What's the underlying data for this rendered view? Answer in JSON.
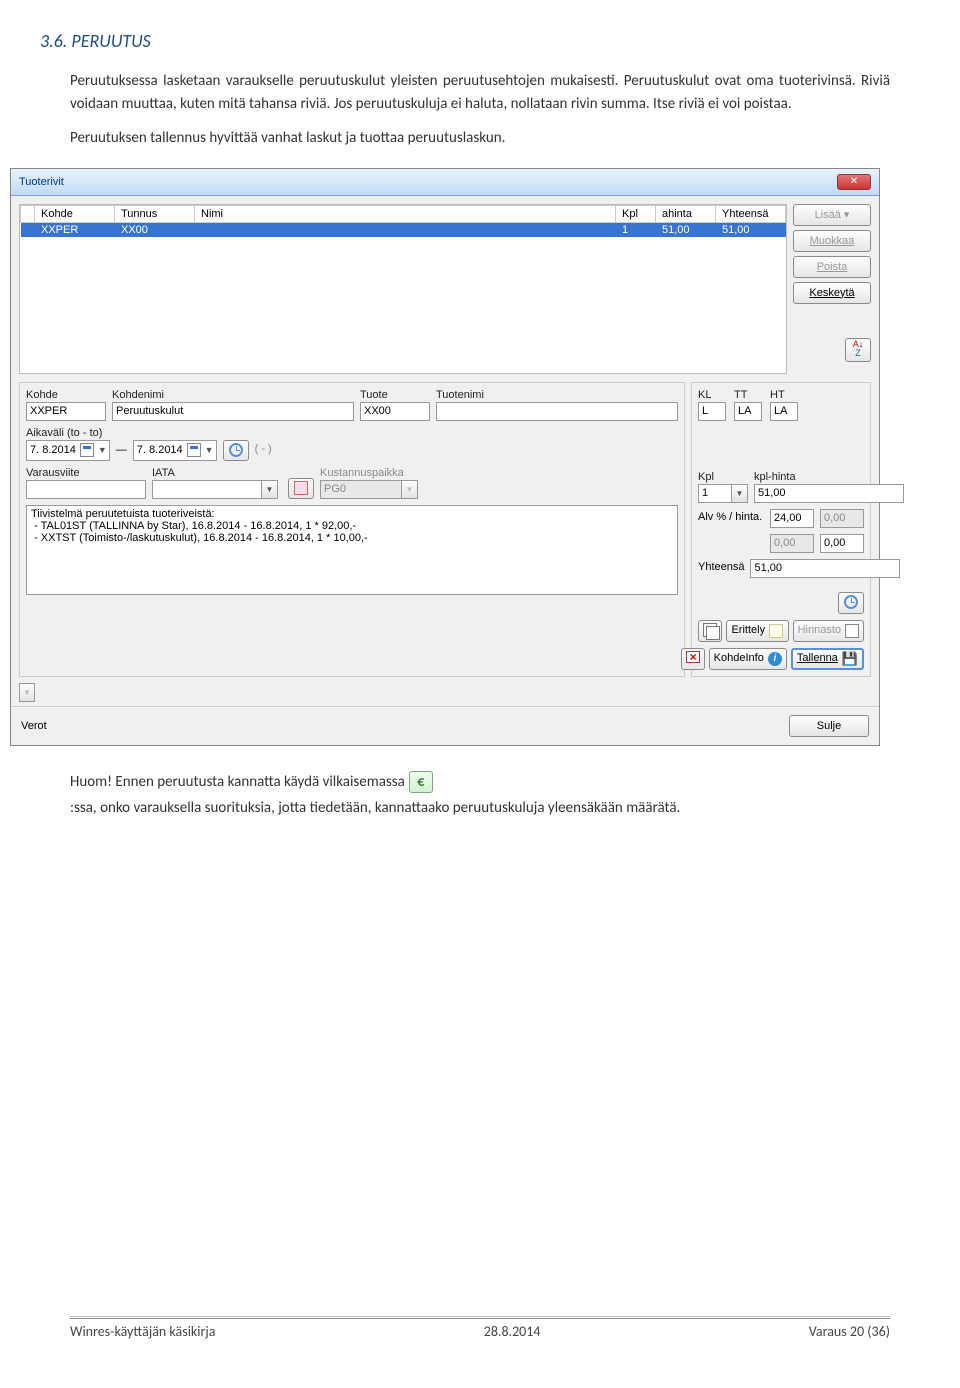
{
  "doc": {
    "heading": "3.6. PERUUTUS",
    "para1": "Peruutuksessa lasketaan varaukselle peruutuskulut yleisten peruutusehtojen mukaisesti. Peruutuskulut ovat oma tuoterivinsä. Riviä voidaan muuttaa, kuten mitä tahansa riviä. Jos peruutuskuluja ei haluta, nollataan rivin summa. Itse riviä ei voi poistaa.",
    "para2": "Peruutuksen tallennus hyvittää vanhat laskut ja tuottaa peruutuslaskun.",
    "note_before": " Huom! Ennen peruutusta kannatta käydä vilkaisemassa ",
    "note_after": ":ssa, onko varauksella suorituksia, jotta tiedetään, kannattaako peruutuskuluja yleensäkään määrätä.",
    "euro": "€"
  },
  "window": {
    "title": "Tuoterivit",
    "grid": {
      "cols": [
        "Kohde",
        "Tunnus",
        "Nimi",
        "Kpl",
        "ahinta",
        "Yhteensä"
      ],
      "row": {
        "kohde": "XXPER",
        "tunnus": "XX00",
        "nimi": "",
        "kpl": "1",
        "ahinta": "51,00",
        "yht": "51,00"
      }
    },
    "buttons": {
      "add": "Lisää ▾",
      "edit": "Muokkaa",
      "delete": "Poista",
      "cancel": "Keskeytä",
      "sort_a": "A",
      "sort_z": "Z"
    },
    "form": {
      "labels": {
        "kohde": "Kohde",
        "kohdenimi": "Kohdenimi",
        "tuote": "Tuote",
        "tuotenimi": "Tuotenimi",
        "kl": "KL",
        "tt": "TT",
        "ht": "HT",
        "aikavali": "Aikaväli (to - to)",
        "varausviite": "Varausviite",
        "iata": "IATA",
        "kustannus": "Kustannuspaikka",
        "kpl": "Kpl",
        "kplhinta": "kpl-hinta",
        "alv": "Alv % / hinta.",
        "yhteensa": "Yhteensä"
      },
      "values": {
        "kohde": "XXPER",
        "kohdenimi": "Peruutuskulut",
        "tuote": "XX00",
        "tuotenimi": "",
        "kl": "L",
        "tt": "LA",
        "ht": "LA",
        "date1": "7. 8.2014",
        "date2": "7. 8.2014",
        "timerange": "( - )",
        "varausviite": "",
        "iata": "",
        "kustannus": "PG0",
        "kpl": "1",
        "kplhinta": "51,00",
        "alvpct": "24,00",
        "alvval": "0,00",
        "z1": "0,00",
        "z2": "0,00",
        "yhteensa": "51,00",
        "summary": "Tiivistelmä peruutetuista tuoteriveistä:\n - TAL01ST (TALLINNA by Star), 16.8.2014 - 16.8.2014, 1 * 92,00,-\n - XXTST (Toimisto-/laskutuskulut), 16.8.2014 - 16.8.2014, 1 * 10,00,-"
      },
      "actions": {
        "erittely": "Erittely",
        "hinnasto": "Hinnasto",
        "kohdeinfo": "KohdeInfo",
        "tallenna": "Tallenna"
      }
    },
    "bottom": {
      "verot": "Verot",
      "sulje": "Sulje"
    }
  },
  "footer": {
    "left": "Winres-käyttäjän käsikirja",
    "center": "28.8.2014",
    "right": "Varaus   20 (36)"
  }
}
